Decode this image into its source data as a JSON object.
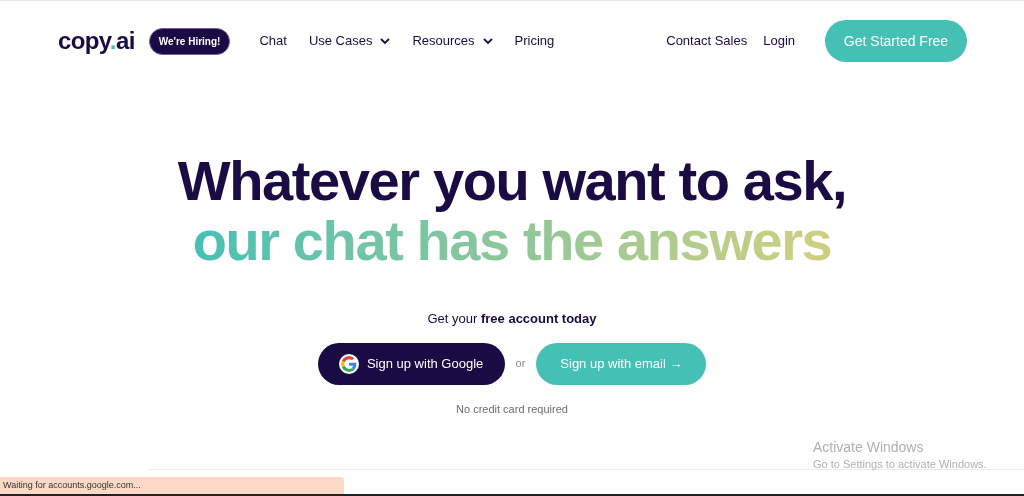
{
  "nav": {
    "logo": {
      "name": "copy",
      "dot": ".",
      "suffix": "ai"
    },
    "badge": "We're Hiring!",
    "links": [
      {
        "label": "Chat",
        "dropdown": false
      },
      {
        "label": "Use Cases",
        "dropdown": true
      },
      {
        "label": "Resources",
        "dropdown": true
      },
      {
        "label": "Pricing",
        "dropdown": false
      }
    ],
    "right_links": [
      "Contact Sales",
      "Login"
    ],
    "cta": "Get Started Free"
  },
  "hero": {
    "title_line_1": "Whatever you want to ask,",
    "title_line_2": "our chat has the answers",
    "subtitle": "Get your **free account today**",
    "google_button": "Sign up with Google",
    "separator": "or",
    "email_button": "Sign up with email →",
    "note": "No credit card required"
  },
  "os_notice": {
    "title": "Activate Windows",
    "text": "Go to Settings to activate Windows."
  },
  "status_bar": "Waiting for accounts.google.com..."
}
